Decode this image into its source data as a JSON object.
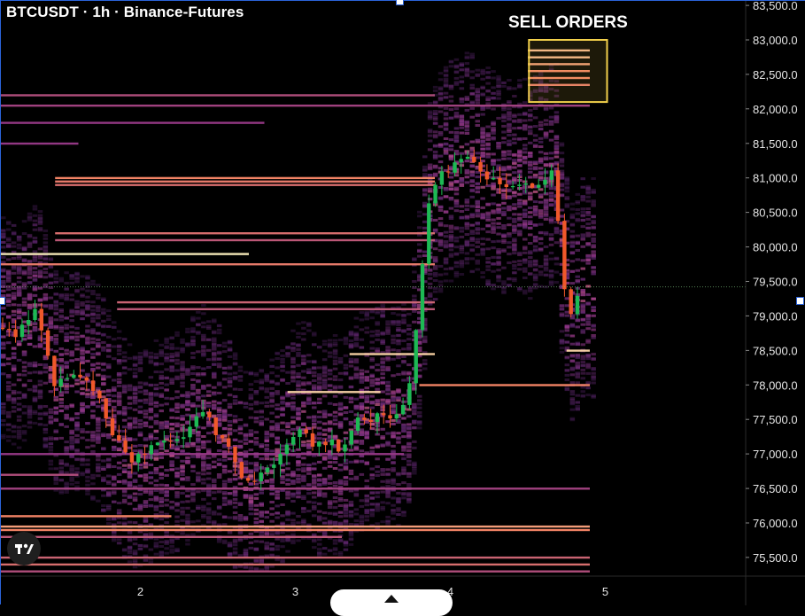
{
  "header": {
    "title": "BTCUSDT · 1h · Binance-Futures"
  },
  "annotation": {
    "label": "SELL ORDERS"
  },
  "colors": {
    "background": "#000000",
    "up_candle": "#1db954",
    "down_candle": "#f0582a",
    "heatmap_low": "#3a1a5a",
    "heatmap_mid": "#9a3a8a",
    "heatmap_high": "#ff8a6a",
    "heatmap_peak": "#fff2c0",
    "annotation_box": "#f2d04b",
    "axis_text": "#e6e6e6",
    "frame": "#2b63d9"
  },
  "icons": {
    "logo": "tradingview-logo-icon",
    "scroll": "chevron-up-icon"
  },
  "chart_data": {
    "type": "heatmap",
    "overlay": "candlestick",
    "symbol": "BTCUSDT",
    "interval": "1h",
    "exchange": "Binance-Futures",
    "x_ticks": [
      "2",
      "3",
      "4",
      "5"
    ],
    "y_ticks": [
      "75,500.0",
      "76,000.0",
      "76,500.0",
      "77,000.0",
      "77,500.0",
      "78,000.0",
      "78,500.0",
      "79,000.0",
      "79,500.0",
      "80,000.0",
      "80,500.0",
      "81,000.0",
      "81,500.0",
      "82,000.0",
      "82,500.0",
      "83,000.0",
      "83,500.0"
    ],
    "ylim": [
      75200,
      83600
    ],
    "x_range_days": [
      1.1,
      5.9
    ],
    "current_price": 79420,
    "candles_path": [
      [
        1.07,
        78900
      ],
      [
        1.2,
        78700
      ],
      [
        1.33,
        79100
      ],
      [
        1.45,
        78000
      ],
      [
        1.58,
        78100
      ],
      [
        1.72,
        77900
      ],
      [
        1.82,
        77300
      ],
      [
        1.95,
        76900
      ],
      [
        2.1,
        77100
      ],
      [
        2.25,
        77200
      ],
      [
        2.4,
        77600
      ],
      [
        2.5,
        77300
      ],
      [
        2.58,
        77000
      ],
      [
        2.68,
        76600
      ],
      [
        2.8,
        76700
      ],
      [
        2.95,
        77200
      ],
      [
        3.05,
        77400
      ],
      [
        3.13,
        77100
      ],
      [
        3.22,
        77200
      ],
      [
        3.3,
        77050
      ],
      [
        3.38,
        77500
      ],
      [
        3.48,
        77500
      ],
      [
        3.55,
        77600
      ],
      [
        3.65,
        77550
      ],
      [
        3.72,
        77700
      ],
      [
        3.78,
        78800
      ],
      [
        3.85,
        80500
      ],
      [
        3.93,
        81000
      ],
      [
        4.03,
        81200
      ],
      [
        4.12,
        81250
      ],
      [
        4.2,
        81100
      ],
      [
        4.3,
        80900
      ],
      [
        4.4,
        80950
      ],
      [
        4.5,
        80850
      ],
      [
        4.6,
        81000
      ],
      [
        4.67,
        81100
      ],
      [
        4.72,
        79600
      ],
      [
        4.78,
        79000
      ],
      [
        4.83,
        79420
      ]
    ],
    "liquidity_bands": [
      {
        "price": 82850,
        "x_from": 4.5,
        "x_to": 4.9,
        "intensity": 0.9
      },
      {
        "price": 82750,
        "x_from": 4.5,
        "x_to": 4.9,
        "intensity": 0.9
      },
      {
        "price": 82650,
        "x_from": 4.5,
        "x_to": 4.9,
        "intensity": 0.85
      },
      {
        "price": 82550,
        "x_from": 4.5,
        "x_to": 4.9,
        "intensity": 0.8
      },
      {
        "price": 82450,
        "x_from": 4.5,
        "x_to": 4.9,
        "intensity": 0.8
      },
      {
        "price": 82350,
        "x_from": 4.5,
        "x_to": 4.9,
        "intensity": 0.75
      },
      {
        "price": 82200,
        "x_from": 1.1,
        "x_to": 3.9,
        "intensity": 0.55
      },
      {
        "price": 82050,
        "x_from": 1.1,
        "x_to": 4.9,
        "intensity": 0.5
      },
      {
        "price": 81800,
        "x_from": 1.1,
        "x_to": 2.8,
        "intensity": 0.45
      },
      {
        "price": 81500,
        "x_from": 1.1,
        "x_to": 1.6,
        "intensity": 0.45
      },
      {
        "price": 81000,
        "x_from": 1.45,
        "x_to": 3.9,
        "intensity": 0.8
      },
      {
        "price": 80950,
        "x_from": 1.45,
        "x_to": 3.9,
        "intensity": 0.75
      },
      {
        "price": 80900,
        "x_from": 1.45,
        "x_to": 3.9,
        "intensity": 0.7
      },
      {
        "price": 80200,
        "x_from": 1.45,
        "x_to": 3.9,
        "intensity": 0.7
      },
      {
        "price": 80100,
        "x_from": 1.45,
        "x_to": 3.9,
        "intensity": 0.6
      },
      {
        "price": 79900,
        "x_from": 1.1,
        "x_to": 2.7,
        "intensity": 1.0
      },
      {
        "price": 79750,
        "x_from": 1.1,
        "x_to": 3.9,
        "intensity": 0.75
      },
      {
        "price": 79200,
        "x_from": 1.85,
        "x_to": 3.9,
        "intensity": 0.65
      },
      {
        "price": 79100,
        "x_from": 1.85,
        "x_to": 3.9,
        "intensity": 0.6
      },
      {
        "price": 78500,
        "x_from": 4.75,
        "x_to": 4.9,
        "intensity": 0.95
      },
      {
        "price": 78450,
        "x_from": 3.35,
        "x_to": 3.9,
        "intensity": 0.95
      },
      {
        "price": 78000,
        "x_from": 3.8,
        "x_to": 4.9,
        "intensity": 0.8
      },
      {
        "price": 77900,
        "x_from": 2.95,
        "x_to": 3.55,
        "intensity": 0.95
      },
      {
        "price": 77000,
        "x_from": 1.1,
        "x_to": 3.7,
        "intensity": 0.45
      },
      {
        "price": 76700,
        "x_from": 1.1,
        "x_to": 1.6,
        "intensity": 0.55
      },
      {
        "price": 76500,
        "x_from": 1.1,
        "x_to": 4.9,
        "intensity": 0.5
      },
      {
        "price": 76100,
        "x_from": 1.1,
        "x_to": 2.2,
        "intensity": 0.8
      },
      {
        "price": 75950,
        "x_from": 1.1,
        "x_to": 4.9,
        "intensity": 0.85
      },
      {
        "price": 75900,
        "x_from": 1.1,
        "x_to": 4.9,
        "intensity": 0.8
      },
      {
        "price": 75800,
        "x_from": 1.1,
        "x_to": 3.3,
        "intensity": 0.6
      },
      {
        "price": 75500,
        "x_from": 1.1,
        "x_to": 4.9,
        "intensity": 0.65
      },
      {
        "price": 75400,
        "x_from": 1.1,
        "x_to": 4.9,
        "intensity": 0.7
      },
      {
        "price": 75300,
        "x_from": 1.1,
        "x_to": 4.9,
        "intensity": 0.55
      }
    ],
    "annotation_box": {
      "label": "SELL ORDERS",
      "price_low": 82100,
      "price_high": 83000,
      "x_from": 4.45,
      "x_to": 5.0
    }
  }
}
